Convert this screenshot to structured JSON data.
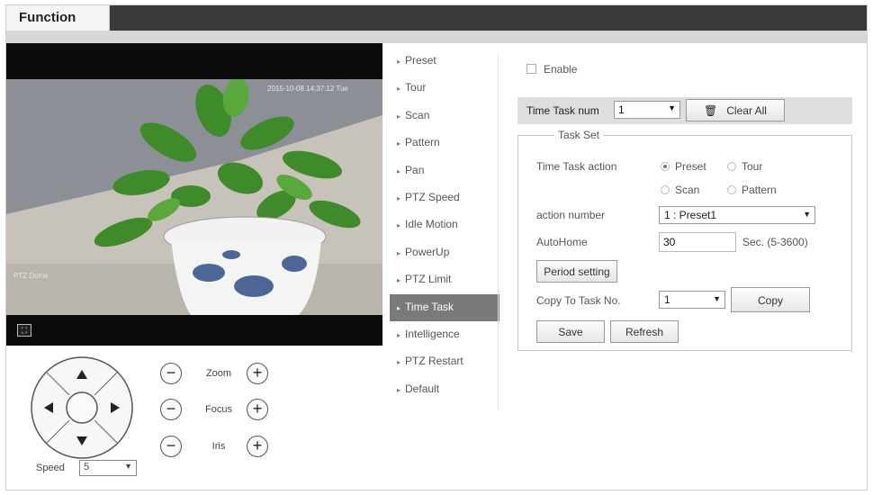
{
  "header": {
    "tab_label": "Function"
  },
  "video": {
    "osd_top_right": "2015-10-08 14:37:12 Tue",
    "osd_bottom_left": "PTZ Dome",
    "fullscreen_icon": "fullscreen-icon"
  },
  "ptz": {
    "zoom_label": "Zoom",
    "focus_label": "Focus",
    "iris_label": "Iris",
    "minus": "−",
    "plus": "+",
    "speed_label": "Speed",
    "speed_value": "5"
  },
  "menu": {
    "items": [
      {
        "label": "Preset"
      },
      {
        "label": "Tour"
      },
      {
        "label": "Scan"
      },
      {
        "label": "Pattern"
      },
      {
        "label": "Pan"
      },
      {
        "label": "PTZ Speed"
      },
      {
        "label": "Idle Motion"
      },
      {
        "label": "PowerUp"
      },
      {
        "label": "PTZ Limit"
      },
      {
        "label": "Time Task",
        "active": true
      },
      {
        "label": "Intelligence"
      },
      {
        "label": "PTZ Restart"
      },
      {
        "label": "Default"
      }
    ]
  },
  "panel": {
    "enable_label": "Enable",
    "time_task_num_label": "Time Task num",
    "time_task_num_value": "1",
    "clear_all_label": "Clear All",
    "task_set_legend": "Task Set",
    "action_label": "Time Task action",
    "action_options": [
      "Preset",
      "Tour",
      "Scan",
      "Pattern"
    ],
    "action_selected": "Preset",
    "action_number_label": "action number",
    "action_number_value": "1 : Preset1",
    "autohome_label": "AutoHome",
    "autohome_value": "30",
    "autohome_unit": "Sec. (5-3600)",
    "period_setting_label": "Period setting",
    "copy_to_label": "Copy To Task No.",
    "copy_to_value": "1",
    "copy_label": "Copy",
    "save_label": "Save",
    "refresh_label": "Refresh"
  }
}
